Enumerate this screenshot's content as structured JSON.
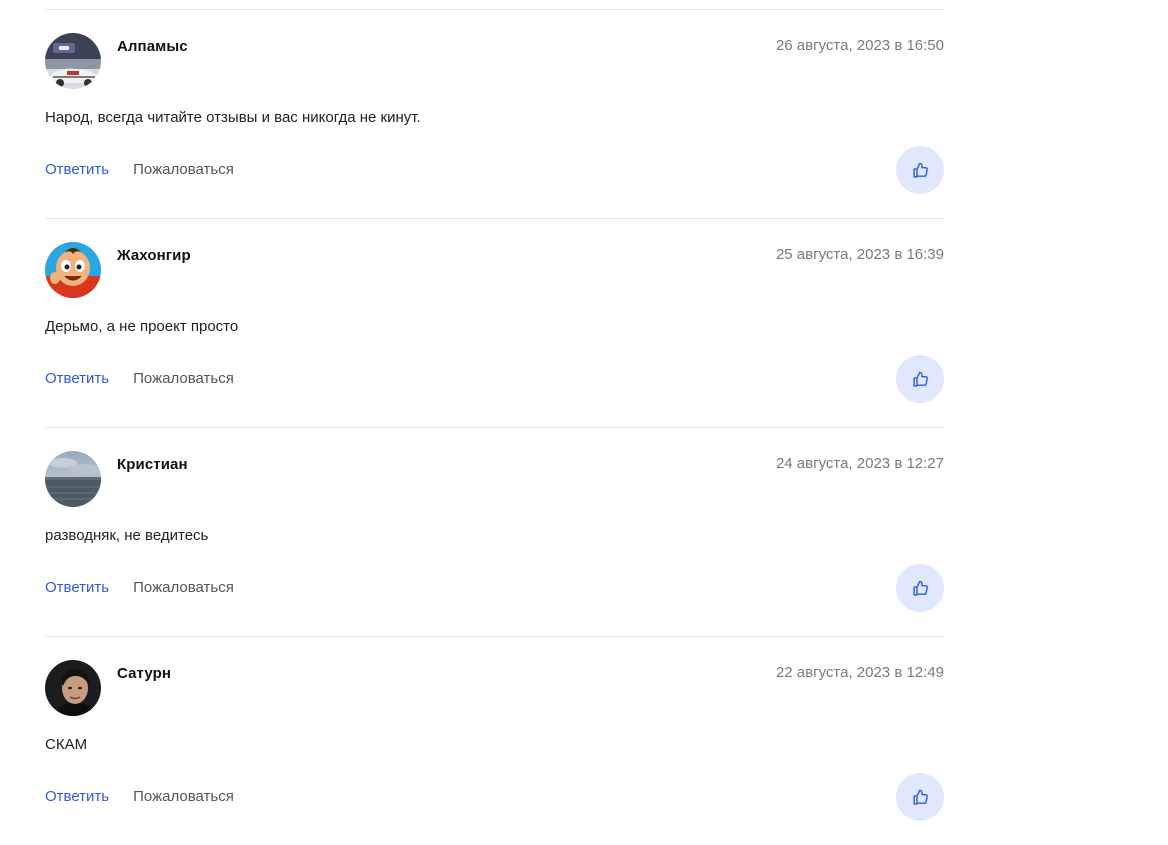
{
  "comments": [
    {
      "author": "Алпамыс",
      "date": "26 августа, 2023 в 16:50",
      "text": "Народ, всегда читайте отзывы и вас никогда не кинут.",
      "reply_label": "Ответить",
      "report_label": "Пожаловаться",
      "avatar_icon": "car-photo-avatar"
    },
    {
      "author": "Жахонгир",
      "date": "25 августа, 2023 в 16:39",
      "text": "Дерьмо, а не проект просто",
      "reply_label": "Ответить",
      "report_label": "Пожаловаться",
      "avatar_icon": "cartoon-baby-avatar"
    },
    {
      "author": "Кристиан",
      "date": "24 августа, 2023 в 12:27",
      "text": "разводняк, не ведитесь",
      "reply_label": "Ответить",
      "report_label": "Пожаловаться",
      "avatar_icon": "sea-landscape-avatar"
    },
    {
      "author": "Сатурн",
      "date": "22 августа, 2023 в 12:49",
      "text": "СКАМ",
      "reply_label": "Ответить",
      "report_label": "Пожаловаться",
      "avatar_icon": "portrait-avatar"
    }
  ],
  "colors": {
    "link": "#2f5bd8",
    "like_bg": "#e1e7fd",
    "date": "#7a7a7a",
    "divider": "#e6e6e6"
  }
}
